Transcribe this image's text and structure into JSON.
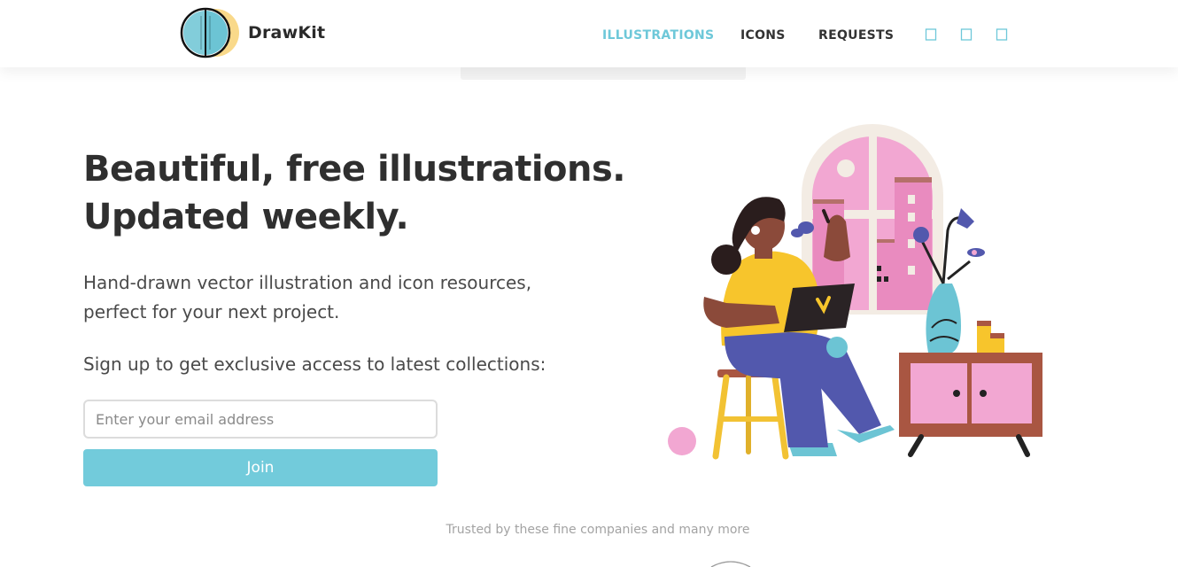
{
  "header": {
    "brand": "DrawKit",
    "logo_icon": "drawkit-logo-icon",
    "nav": [
      {
        "label": "ILLUSTRATIONS",
        "active": true
      },
      {
        "label": "ICONS",
        "active": false
      },
      {
        "label": "REQUESTS",
        "active": false
      }
    ],
    "social_icons": [
      "social-icon",
      "social-icon",
      "social-icon"
    ]
  },
  "hero": {
    "headline_line1": "Beautiful, free illustrations.",
    "headline_line2": "Updated weekly.",
    "subtext_line1": "Hand-drawn vector illustration and icon resources,",
    "subtext_line2": "perfect for your next project.",
    "signup_label": "Sign up to get exclusive access to latest collections:",
    "email_placeholder": "Enter your email address",
    "email_value": "",
    "join_label": "Join",
    "illustration": "woman-with-laptop-illustration"
  },
  "trusted_text": "Trusted by these fine companies and many more",
  "colors": {
    "accent": "#72cbdb",
    "nav_active": "#6ec8d9",
    "text_dark": "#2f2f2f",
    "text_muted": "#a3a3a3"
  }
}
